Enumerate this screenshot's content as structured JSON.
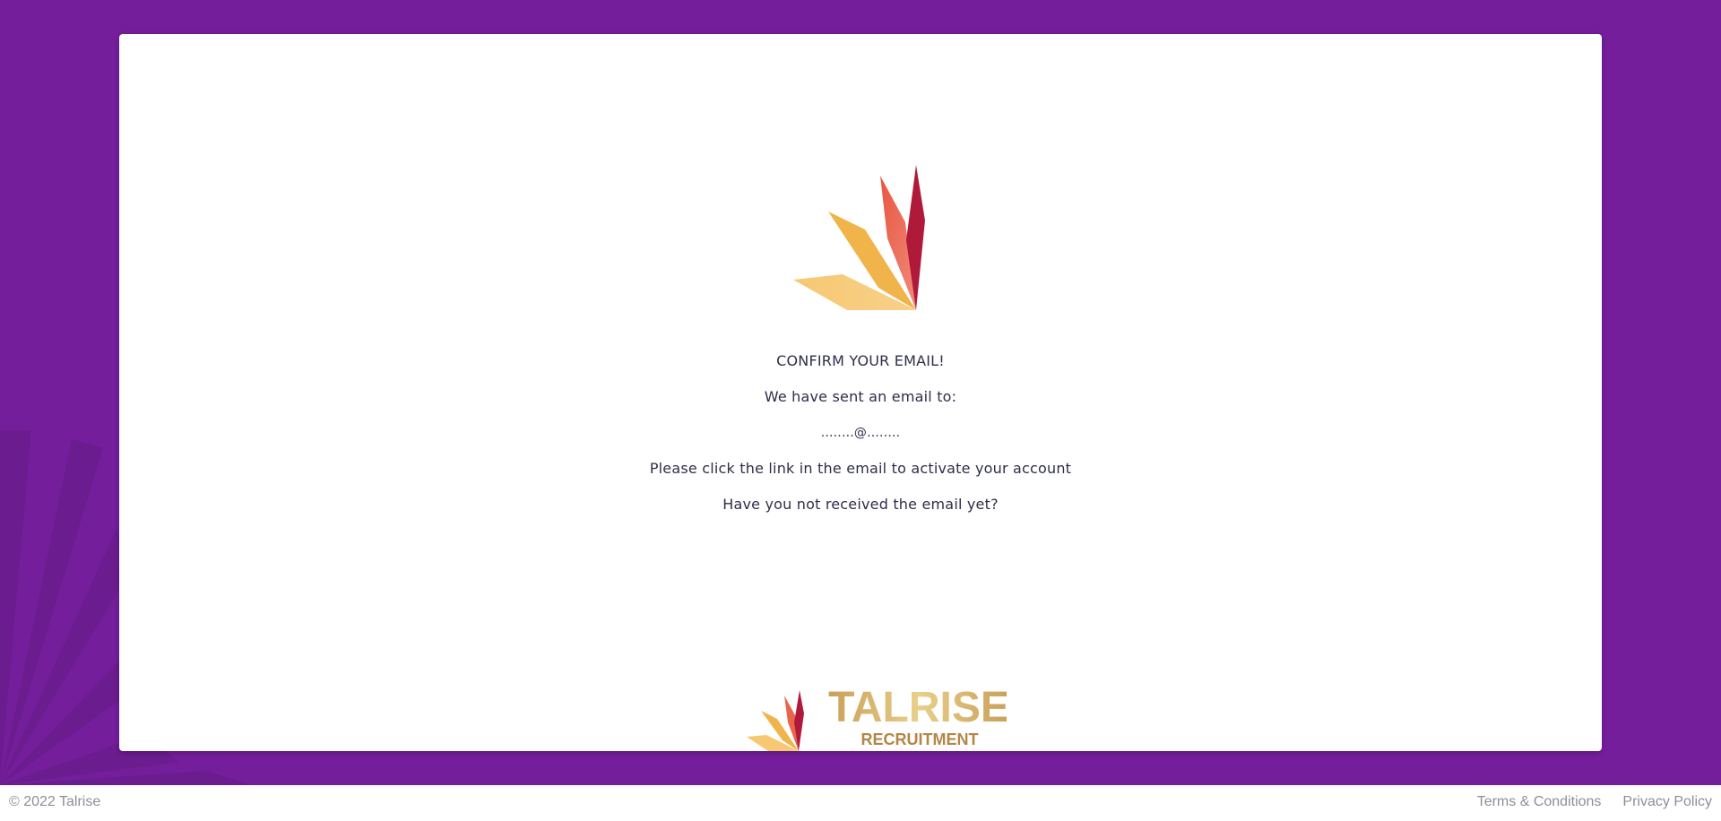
{
  "colors": {
    "background": "#741e9b",
    "card": "#ffffff",
    "text": "#2e2e4a",
    "footer_text": "#8e8e99",
    "logo_gold": "#d9b26a",
    "logo_red": "#b01a3a"
  },
  "card": {
    "heading": "CONFIRM YOUR EMAIL!",
    "sent_to": "We have sent an email to:",
    "email": "........@........",
    "instruction": "Please click the link in the email to activate your account",
    "resend_prompt": "Have you not received the email yet?"
  },
  "brand": {
    "name": "TALRISE",
    "tagline": "RECRUITMENT"
  },
  "footer": {
    "copyright": "© 2022 Talrise",
    "links": [
      "Terms & Conditions",
      "Privacy Policy"
    ]
  }
}
